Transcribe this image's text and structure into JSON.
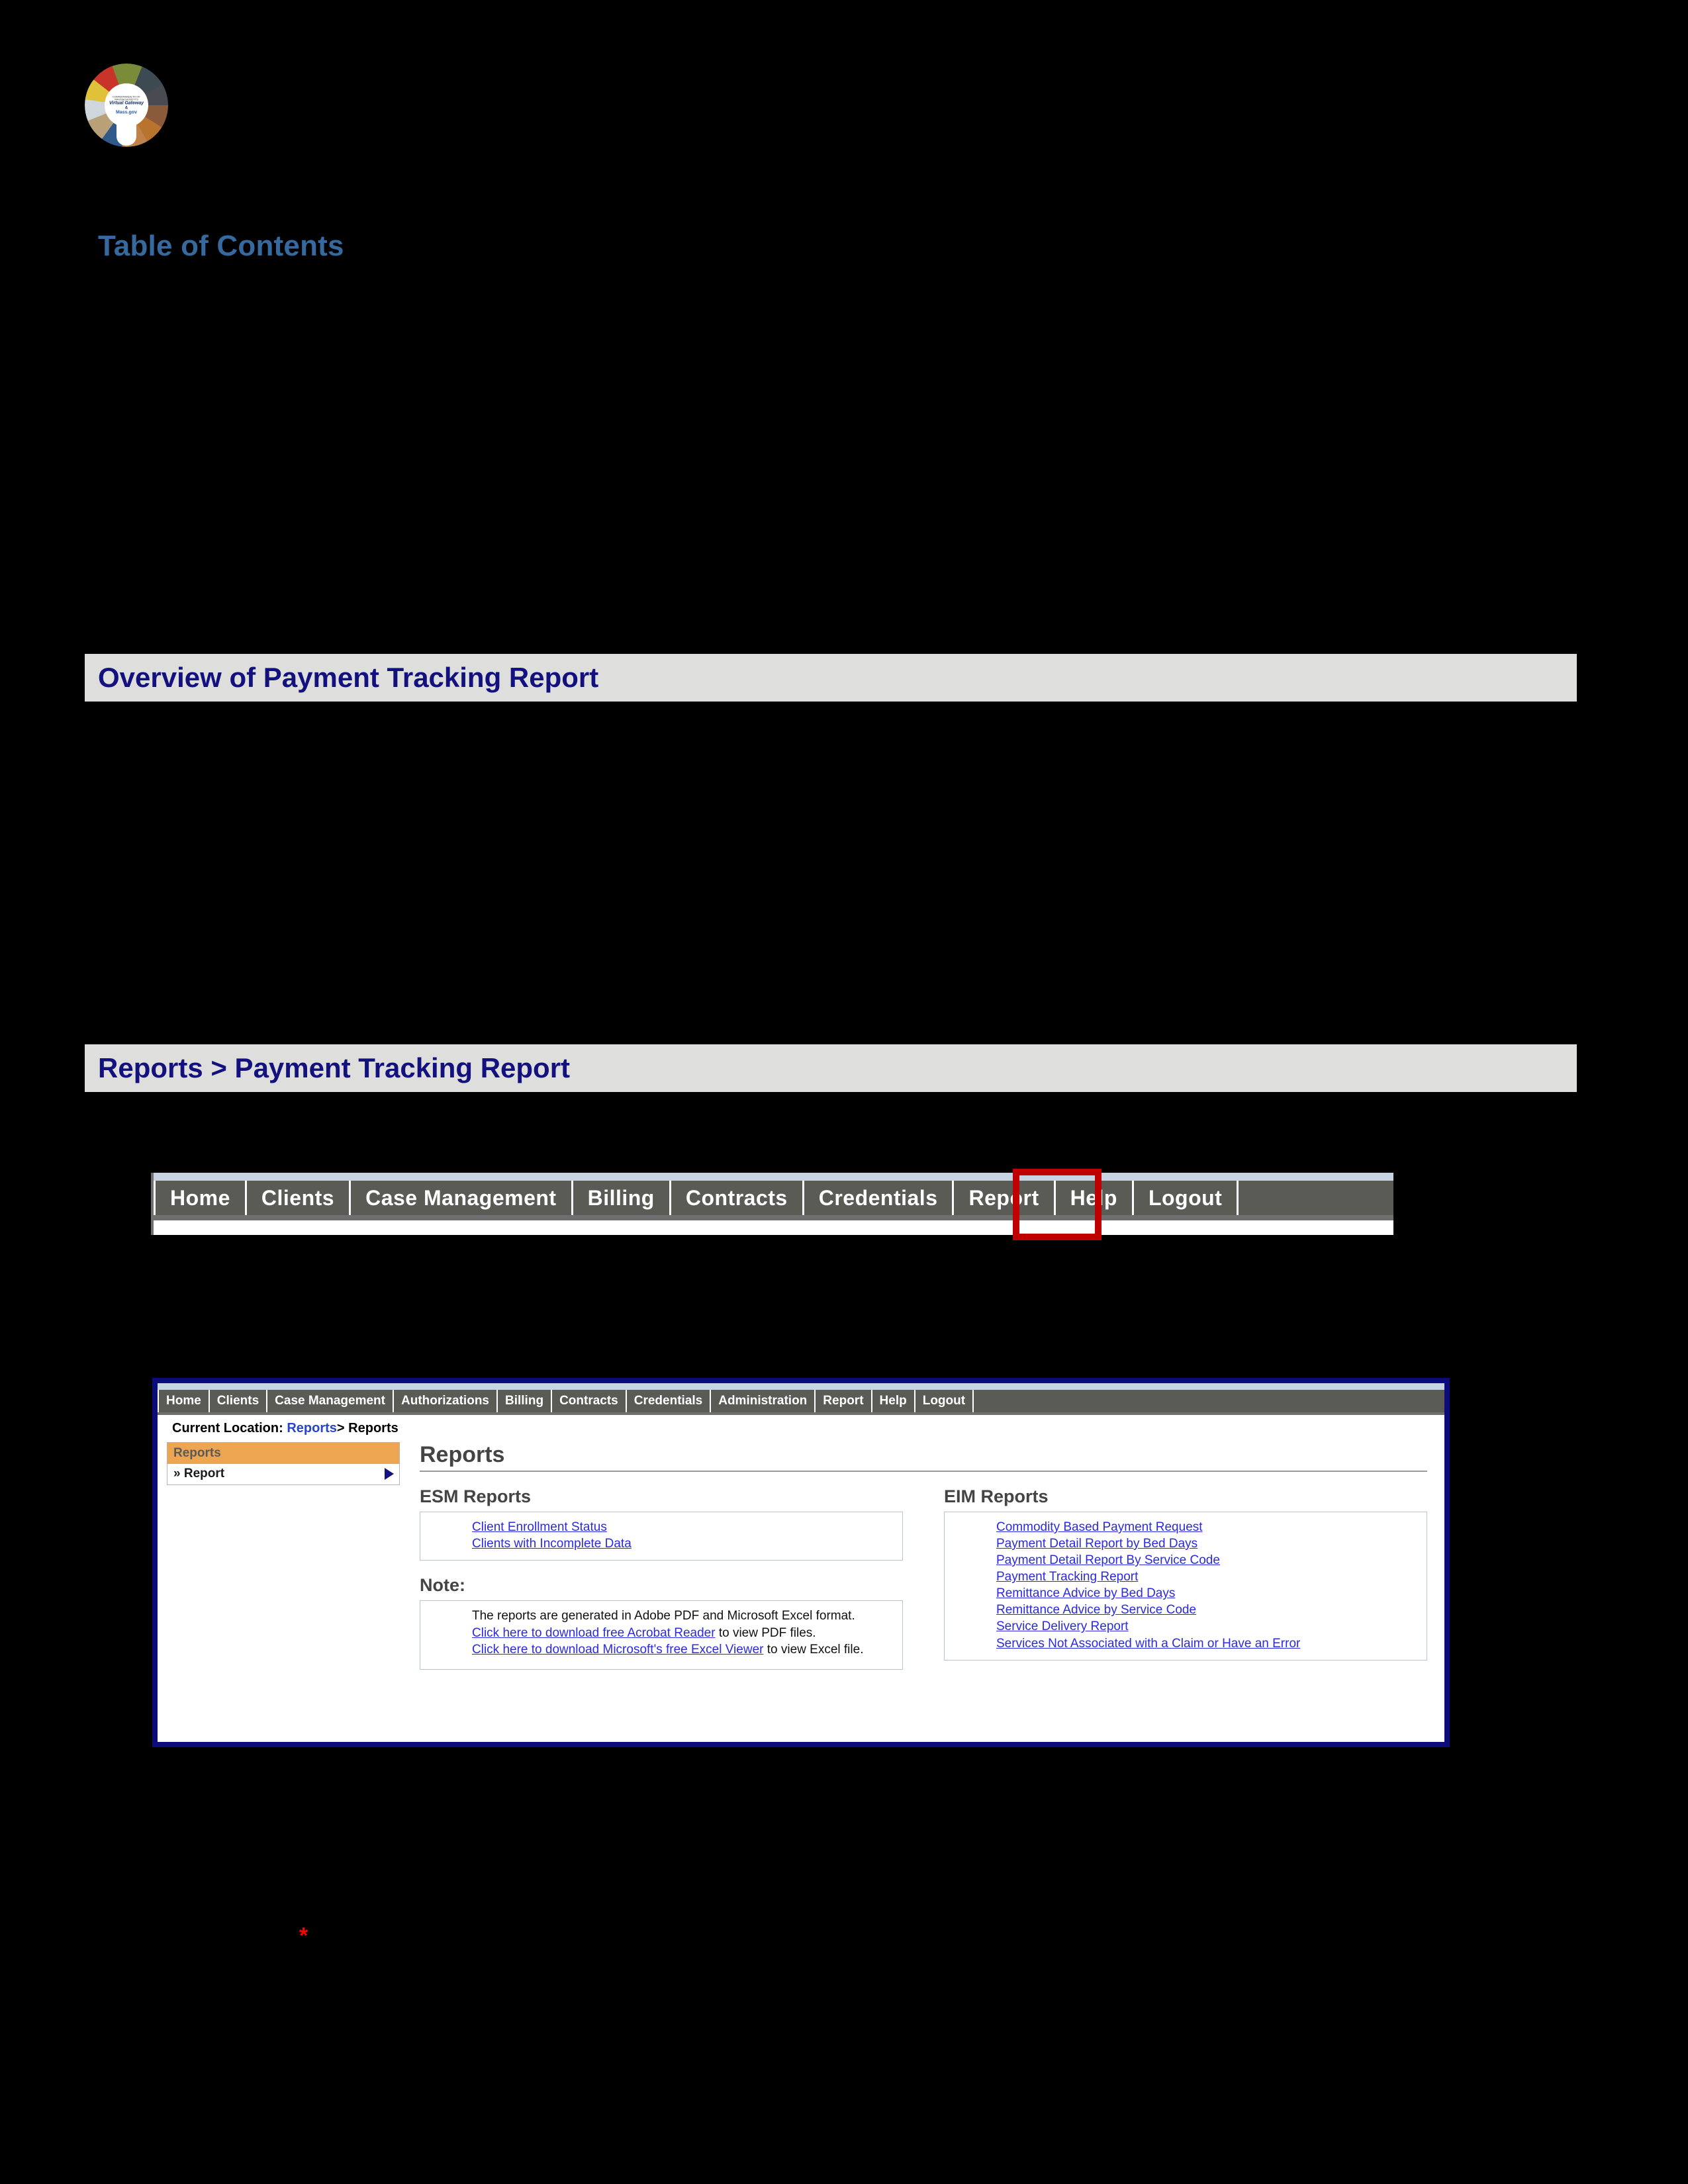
{
  "page": {
    "background_color": "#000000",
    "banner_background": "#dededd",
    "banner_text_color": "#13117e",
    "toc_heading_color": "#36699e",
    "highlight_color": "#c00000",
    "link_color": "#2a2ae0",
    "sidebar_header_color": "#eea552"
  },
  "logo": {
    "name": "virtual-gateway-mass-gov-logo",
    "line1": "COMMONWEALTH OF MASSACHUSETTS",
    "line2": "Virtual Gateway",
    "line3": "&",
    "line4": "Mass.gov"
  },
  "toc": {
    "heading": "Table of Contents"
  },
  "sections": [
    {
      "title": "Overview of Payment Tracking Report"
    },
    {
      "title": "Reports > Payment Tracking Report"
    }
  ],
  "top_nav": {
    "items": [
      "Home",
      "Clients",
      "Case Management",
      "Billing",
      "Contracts",
      "Credentials",
      "Report",
      "Help",
      "Logout"
    ],
    "highlighted_item": "Report"
  },
  "app_screenshot": {
    "nav_items": [
      "Home",
      "Clients",
      "Case Management",
      "Authorizations",
      "Billing",
      "Contracts",
      "Credentials",
      "Administration",
      "Report",
      "Help",
      "Logout"
    ],
    "breadcrumb": {
      "label": "Current Location:",
      "link": "Reports",
      "tail": "> Reports"
    },
    "sidebar": {
      "header": "Reports",
      "items": [
        {
          "label": "» Report"
        }
      ]
    },
    "main": {
      "title": "Reports",
      "esm": {
        "title": "ESM Reports",
        "links": [
          "Client Enrollment Status",
          "Clients with Incomplete Data"
        ]
      },
      "eim": {
        "title": "EIM Reports",
        "links": [
          "Commodity Based Payment Request",
          "Payment Detail Report by Bed Days",
          "Payment Detail Report By Service Code",
          "Payment Tracking Report",
          "Remittance Advice by Bed Days",
          "Remittance Advice by Service Code",
          "Service Delivery Report",
          "Services Not Associated with a Claim or Have an Error"
        ]
      },
      "note": {
        "title": "Note:",
        "line1": "The reports are generated in Adobe PDF and Microsoft Excel format.",
        "line2_link": "Click here to download free Acrobat Reader",
        "line2_rest": " to view PDF files.",
        "line3_link": "Click here to download Microsoft's free Excel Viewer",
        "line3_rest": " to view Excel file."
      }
    }
  },
  "footnote": {
    "asterisk": "*"
  }
}
